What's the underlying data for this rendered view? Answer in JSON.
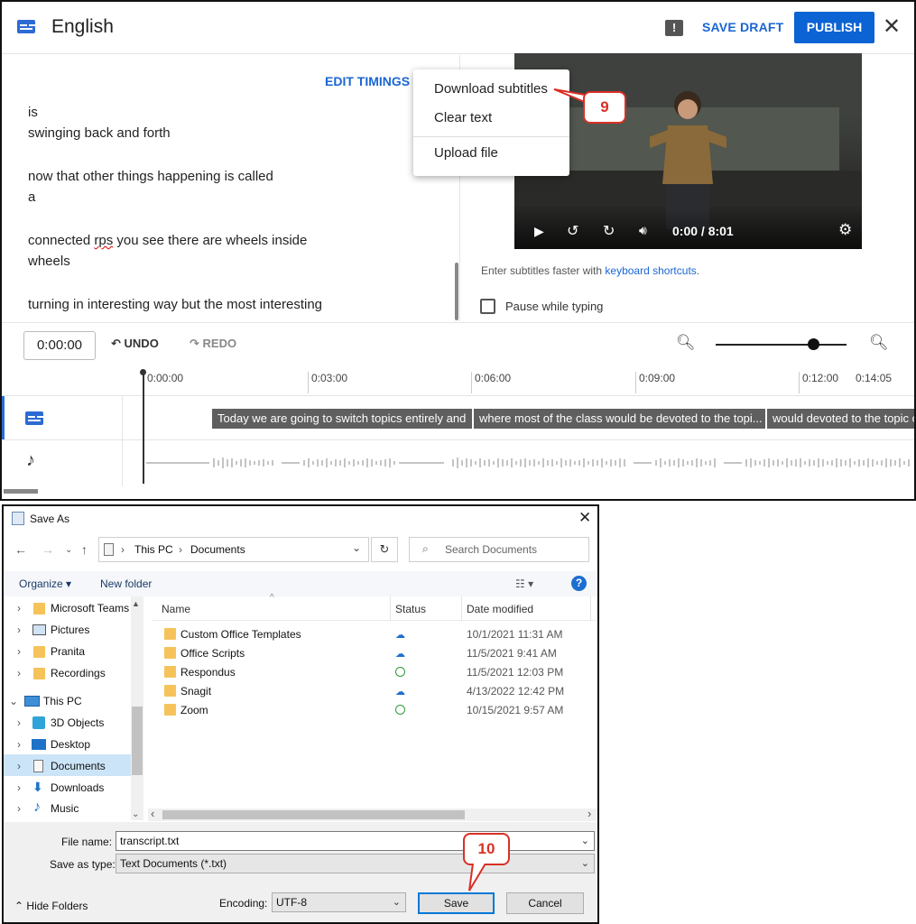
{
  "studio": {
    "title": "English",
    "save_draft": "SAVE DRAFT",
    "publish": "PUBLISH",
    "edit_timings": "EDIT TIMINGS",
    "caption_lines": [
      "is",
      "swinging back and forth",
      "now that other things happening is called",
      "a",
      "connected rps you see there are wheels inside",
      "wheels",
      "turning in interesting way but the most interesting"
    ],
    "menu": {
      "items": [
        "Download subtitles",
        "Clear text",
        "Upload file"
      ]
    },
    "callout_9": "9",
    "video": {
      "time": "0:00 / 8:01"
    },
    "hint_prefix": "Enter subtitles faster with ",
    "hint_link": "keyboard shortcuts",
    "hint_suffix": ".",
    "pause_label": "Pause while typing",
    "toolbar": {
      "time": "0:00:00",
      "undo": "UNDO",
      "redo": "REDO",
      "zoom_level": 0.75
    },
    "ruler": [
      "0:00:00",
      "0:03:00",
      "0:06:00",
      "0:09:00",
      "0:12:00",
      "0:14:05"
    ],
    "segments": [
      "Today we are going to switch topics entirely and",
      "where most of the class would be devoted to the topi...",
      "would devoted to the topic o"
    ]
  },
  "dialog": {
    "title": "Save As",
    "address": [
      "This PC",
      "Documents"
    ],
    "search_placeholder": "Search Documents",
    "organize": "Organize",
    "new_folder": "New folder",
    "nav_items": [
      {
        "label": "Microsoft Teams",
        "icon": "folder-icon"
      },
      {
        "label": "Pictures",
        "icon": "pictures-icon"
      },
      {
        "label": "Pranita",
        "icon": "user-folder-icon"
      },
      {
        "label": "Recordings",
        "icon": "folder-icon"
      },
      {
        "label": "This PC",
        "icon": "pc-icon"
      },
      {
        "label": "3D Objects",
        "icon": "cube-icon"
      },
      {
        "label": "Desktop",
        "icon": "desktop-icon"
      },
      {
        "label": "Documents",
        "icon": "documents-icon"
      },
      {
        "label": "Downloads",
        "icon": "download-icon"
      },
      {
        "label": "Music",
        "icon": "music-icon"
      }
    ],
    "columns": [
      "Name",
      "Status",
      "Date modified"
    ],
    "files": [
      {
        "name": "Custom Office Templates",
        "status": "cloud",
        "date": "10/1/2021 11:31 AM"
      },
      {
        "name": "Office Scripts",
        "status": "cloud",
        "date": "11/5/2021 9:41 AM"
      },
      {
        "name": "Respondus",
        "status": "synced",
        "date": "11/5/2021 12:03 PM"
      },
      {
        "name": "Snagit",
        "status": "cloud",
        "date": "4/13/2022 12:42 PM"
      },
      {
        "name": "Zoom",
        "status": "synced",
        "date": "10/15/2021 9:57 AM"
      }
    ],
    "file_name_label": "File name:",
    "file_name": "transcript.txt",
    "save_type_label": "Save as type:",
    "save_type": "Text Documents (*.txt)",
    "hide_folders": "Hide Folders",
    "encoding_label": "Encoding:",
    "encoding": "UTF-8",
    "save": "Save",
    "cancel": "Cancel",
    "callout_10": "10"
  }
}
